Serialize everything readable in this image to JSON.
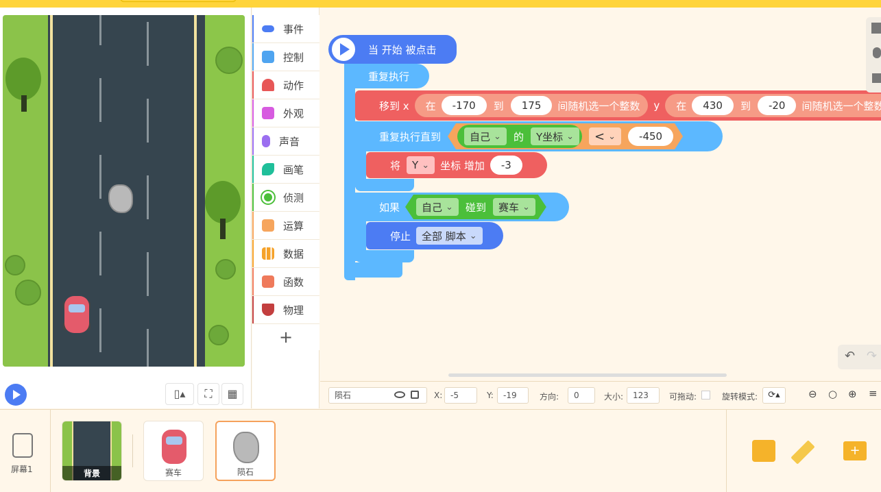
{
  "stage": {
    "screen_label": "屏幕1"
  },
  "categories": [
    {
      "label": "事件",
      "icon": "toggle-icon",
      "color": "#4c7cf3"
    },
    {
      "label": "控制",
      "icon": "gamepad-icon",
      "color": "#4fa4f0"
    },
    {
      "label": "动作",
      "icon": "ghost-icon",
      "color": "#e75757"
    },
    {
      "label": "外观",
      "icon": "shirt-icon",
      "color": "#d75be0"
    },
    {
      "label": "声音",
      "icon": "microphone-icon",
      "color": "#9b6ef0"
    },
    {
      "label": "画笔",
      "icon": "pen-icon",
      "color": "#1fbf9a"
    },
    {
      "label": "侦测",
      "icon": "target-icon",
      "color": "#4bbf3a"
    },
    {
      "label": "运算",
      "icon": "calculator-icon",
      "color": "#f6a55d"
    },
    {
      "label": "数据",
      "icon": "bar-chart-icon",
      "color": "#f5a22a"
    },
    {
      "label": "函数",
      "icon": "function-icon",
      "color": "#ef7a5b"
    },
    {
      "label": "物理",
      "icon": "magnet-icon",
      "color": "#c33f3f"
    }
  ],
  "add_label": "+",
  "code": {
    "hat": "当 开始 被点击",
    "forever": "重复执行",
    "goto": {
      "label": "移到 x",
      "x_in": "在",
      "x_min": "-170",
      "x_to": "到",
      "x_max": "175",
      "x_rand": "间随机选一个整数",
      "y_label": "y",
      "y_in": "在",
      "y_min": "430",
      "y_to": "到",
      "y_max": "-20",
      "y_rand": "间随机选一个整数"
    },
    "repeat_until": {
      "label": "重复执行直到",
      "self": "自己",
      "of": "的",
      "prop": "Y坐标",
      "op": "<",
      "value": "-450"
    },
    "change_y": {
      "label": "将",
      "axis": "Y",
      "text": "坐标 增加",
      "value": "-3"
    },
    "if_block": {
      "label": "如果",
      "self": "自己",
      "touch": "碰到",
      "target": "赛车"
    },
    "stop": {
      "label": "停止",
      "option": "全部 脚本"
    }
  },
  "props": {
    "sprite_name": "陨石",
    "x_label": "X:",
    "x_value": "-5",
    "y_label": "Y:",
    "y_value": "-19",
    "dir_label": "方向:",
    "dir_value": "0",
    "size_label": "大小:",
    "size_value": "123",
    "drag_label": "可拖动:",
    "rot_label": "旋转模式:"
  },
  "sprites": [
    {
      "label": "背景"
    },
    {
      "label": "赛车"
    },
    {
      "label": "陨石"
    }
  ]
}
